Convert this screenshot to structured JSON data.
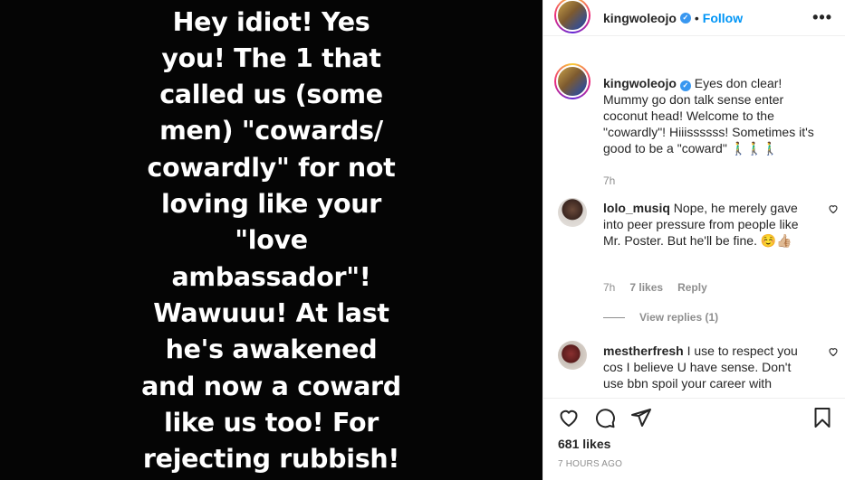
{
  "media": {
    "text": "Hey idiot! Yes\nyou! The 1 that\ncalled us (some\nmen) \"cowards/\ncowardly\" for not\nloving like your\n\"love\nambassador\"!\nWawuuu! At last\nhe's awakened\nand now a coward\nlike us too! For\nrejecting rubbish!"
  },
  "header": {
    "username": "kingwoleojo",
    "separator": "•",
    "follow_label": "Follow",
    "more_label": "•••"
  },
  "caption": {
    "username": "kingwoleojo",
    "text": "Eyes don clear! Mummy go don talk sense enter coconut head! Welcome to the \"cowardly\"! Hiiissssss! Sometimes it's good to be a \"coward\" 🚶‍♂️🚶‍♂️🚶‍♂️",
    "time": "7h"
  },
  "comments": [
    {
      "username": "lolo_musiq",
      "text": "Nope, he merely gave into peer pressure from people like Mr. Poster. But he'll be fine. ☺️👍🏼",
      "time": "7h",
      "likes": "7 likes",
      "reply_label": "Reply",
      "view_replies": "View replies (1)"
    },
    {
      "username": "mestherfresh",
      "text": "I use to respect you cos I believe U have sense. Don't use bbn spoil your career with"
    }
  ],
  "actions": {
    "likes": "681 likes",
    "posted": "7 HOURS AGO"
  },
  "colors": {
    "accent": "#0095f6",
    "verified": "#3897f0",
    "muted": "#8e8e8e",
    "text": "#262626"
  }
}
